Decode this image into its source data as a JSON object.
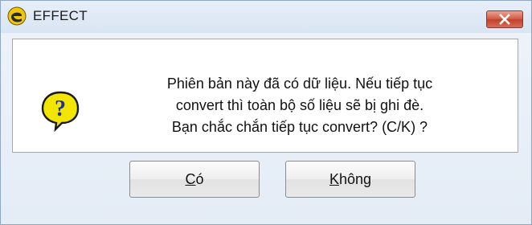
{
  "window": {
    "title": "EFFECT",
    "app_icon": "effect-logo-icon",
    "close_icon": "close-icon"
  },
  "message": {
    "lines": [
      "Phiên bản này đã có dữ liệu. Nếu tiếp tục",
      "convert thì toàn bộ số liệu sẽ bị ghi đè.",
      "Bạn chắc chắn tiếp tục convert? (C/K) ?"
    ],
    "icon": "question-icon"
  },
  "buttons": {
    "yes": {
      "mnemonic": "C",
      "rest": "ó"
    },
    "no": {
      "mnemonic": "K",
      "rest": "hông"
    }
  },
  "colors": {
    "close_button": "#c2402a",
    "icon_yellow": "#f2e600",
    "icon_blue": "#1f2f9a"
  }
}
